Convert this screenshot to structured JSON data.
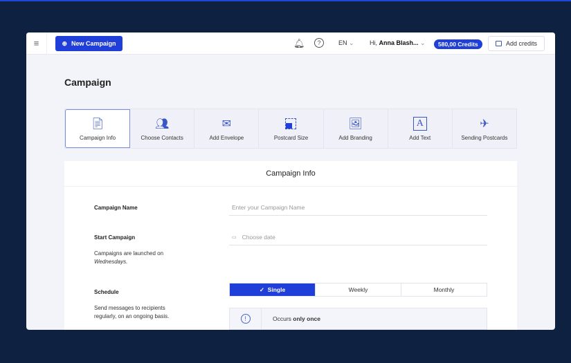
{
  "header": {
    "menu_icon": "hamburger-icon",
    "new_campaign": "New Campaign",
    "language": "EN",
    "greeting": "Hi,",
    "user": "Anna Blash...",
    "credits": "580,00 Credits",
    "add_credits": "Add credits"
  },
  "page": {
    "title": "Campaign"
  },
  "steps": [
    {
      "label": "Campaign Info",
      "icon": "document-icon"
    },
    {
      "label": "Choose Contacts",
      "icon": "contacts-icon"
    },
    {
      "label": "Add Envelope",
      "icon": "envelope-icon"
    },
    {
      "label": "Postcard Size",
      "icon": "size-icon"
    },
    {
      "label": "Add Branding",
      "icon": "image-icon"
    },
    {
      "label": "Add Text",
      "icon": "text-icon"
    },
    {
      "label": "Sending Postcards",
      "icon": "send-icon"
    }
  ],
  "form": {
    "title": "Campaign Info",
    "name_label": "Campaign Name",
    "name_placeholder": "Enter your Campaign Name",
    "start_label": "Start Campaign",
    "date_placeholder": "Choose date",
    "start_desc": "Campaigns are launched on",
    "start_day": "Wednesdays.",
    "schedule_label": "Schedule",
    "schedule_desc1": "Send messages to recipients",
    "schedule_desc2": "regularly, on an ongoing basis.",
    "schedule_options": [
      "Single",
      "Weekly",
      "Monthly"
    ],
    "selected": "Single",
    "note_prefix": "Occurs",
    "note_bold": "only once"
  },
  "colors": {
    "accent": "#1f3fd8",
    "background": "#0f2140"
  }
}
